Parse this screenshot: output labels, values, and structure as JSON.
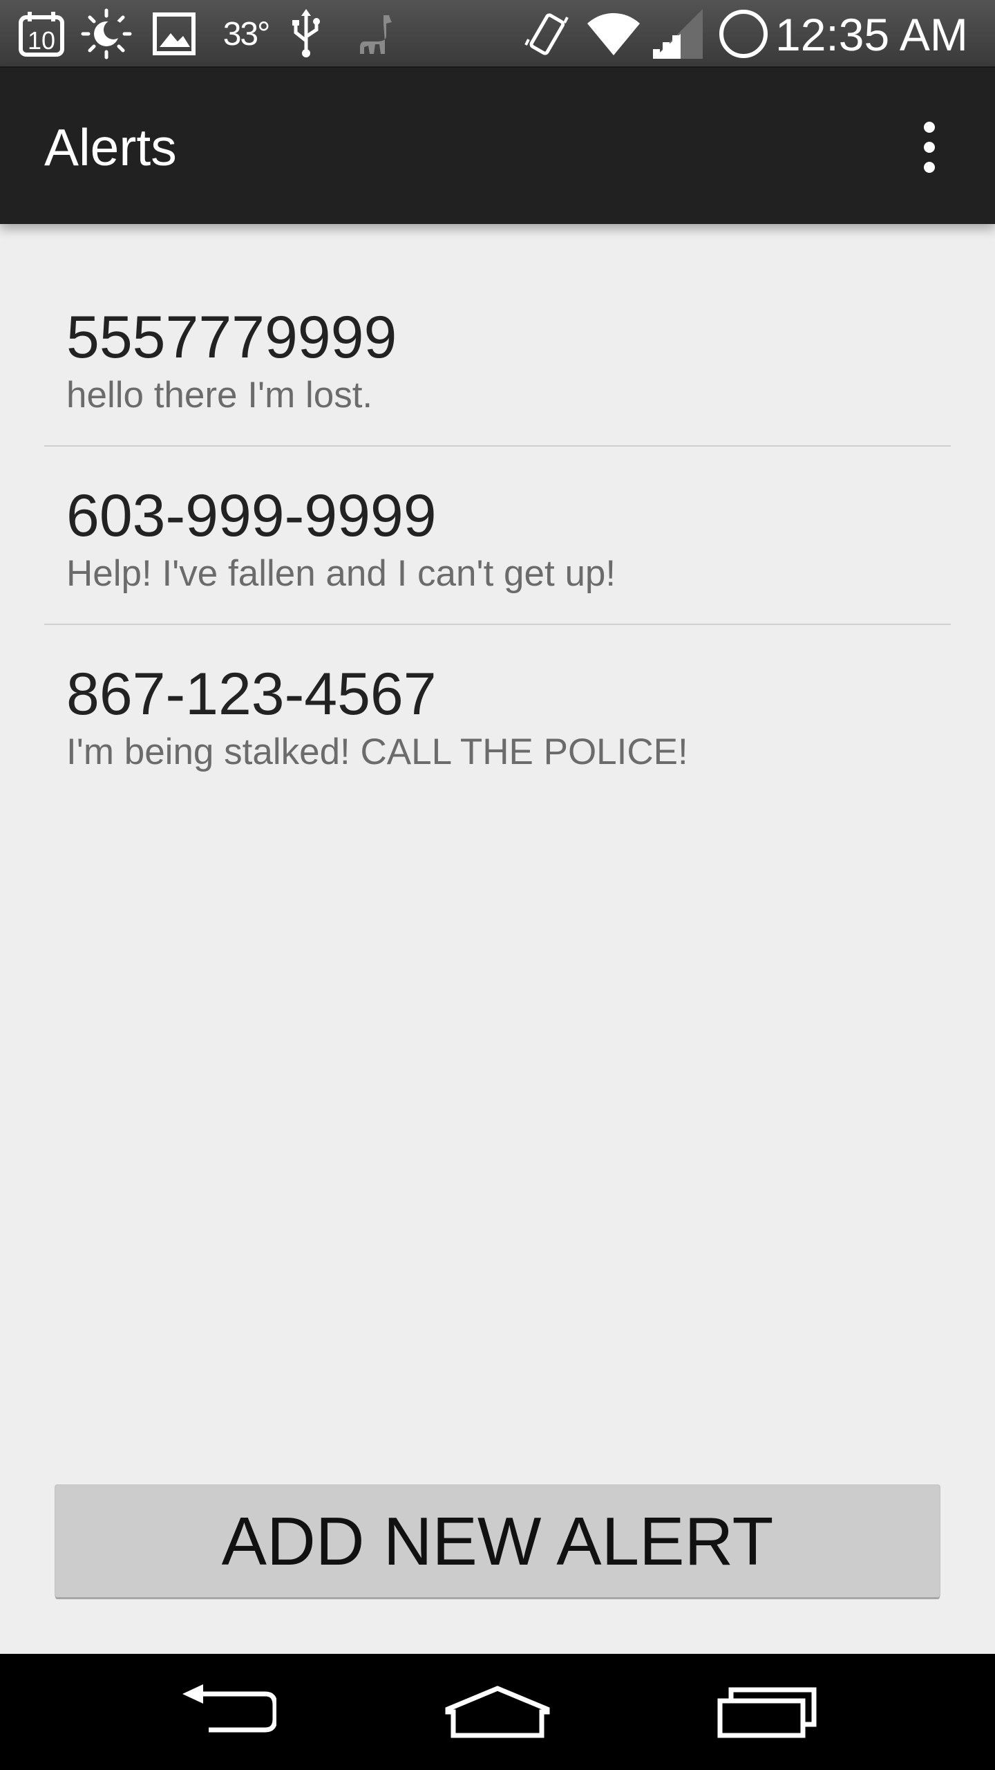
{
  "status_bar": {
    "notification_icons": [
      "calendar-icon",
      "weather-icon",
      "gallery-icon",
      "usb-icon",
      "llama-icon"
    ],
    "calendar_day": "10",
    "temperature": "33°",
    "system_icons": [
      "vibrate-icon",
      "wifi-icon",
      "signal-icon",
      "alarm-ring-icon"
    ],
    "time": "12:35 AM"
  },
  "action_bar": {
    "title": "Alerts",
    "overflow_icon": "overflow-menu-icon"
  },
  "alerts": [
    {
      "number": "5557779999",
      "message": "hello there I'm lost."
    },
    {
      "number": "603-999-9999",
      "message": "Help! I've fallen and I can't get up!"
    },
    {
      "number": "867-123-4567",
      "message": "I'm being stalked! CALL THE POLICE!"
    }
  ],
  "add_button": {
    "label": "ADD NEW ALERT"
  },
  "nav_bar": {
    "buttons": [
      "back-icon",
      "home-icon",
      "recent-apps-icon"
    ]
  },
  "colors": {
    "status_bar": "#474747",
    "action_bar": "#212121",
    "background": "#eeeeee",
    "button": "#cccccc",
    "nav_bar": "#000000"
  }
}
